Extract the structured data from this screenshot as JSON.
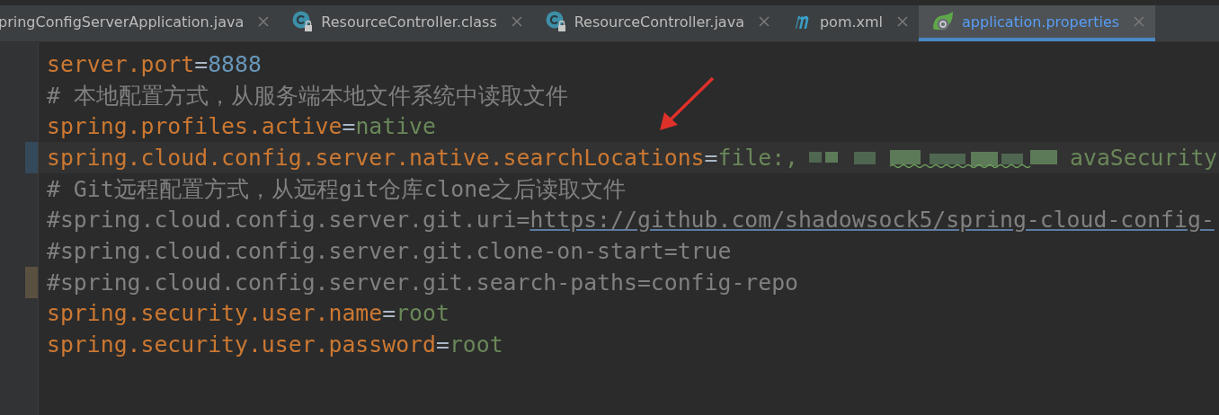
{
  "tabs": [
    {
      "label": "pringConfigServerApplication.java",
      "kind": "plain",
      "selected": false
    },
    {
      "label": "ResourceController.class",
      "kind": "class",
      "selected": false
    },
    {
      "label": "ResourceController.java",
      "kind": "class",
      "selected": false
    },
    {
      "label": "pom.xml",
      "kind": "maven",
      "selected": false
    },
    {
      "label": "application.properties",
      "kind": "spring",
      "selected": true
    }
  ],
  "editor": {
    "lines": [
      {
        "segments": [
          {
            "kind": "key",
            "text": "server.port"
          },
          {
            "kind": "op",
            "text": "="
          },
          {
            "kind": "number",
            "text": "8888"
          }
        ]
      },
      {
        "segments": [
          {
            "kind": "comment",
            "text": "# 本地配置方式，从服务端本地文件系统中读取文件"
          }
        ]
      },
      {
        "segments": [
          {
            "kind": "key",
            "text": "spring.profiles.active"
          },
          {
            "kind": "op",
            "text": "="
          },
          {
            "kind": "value",
            "text": "native"
          }
        ]
      },
      {
        "current": true,
        "segments": [
          {
            "kind": "key",
            "text": "spring.cloud.config.server.native.searchLocations"
          },
          {
            "kind": "op",
            "text": "="
          },
          {
            "kind": "value",
            "text": "file:,"
          },
          {
            "kind": "redacted"
          },
          {
            "kind": "value",
            "text": "avaSecurity"
          }
        ]
      },
      {
        "segments": [
          {
            "kind": "comment",
            "text": "# Git远程配置方式，从远程git仓库clone之后读取文件"
          }
        ]
      },
      {
        "segments": [
          {
            "kind": "comment",
            "text": "#spring.cloud.config.server.git.uri="
          },
          {
            "kind": "link",
            "text": "https://github.com/shadowsock5/spring-cloud-config-"
          }
        ]
      },
      {
        "segments": [
          {
            "kind": "comment",
            "text": "#spring.cloud.config.server.git.clone-on-start=true"
          }
        ]
      },
      {
        "changed": true,
        "segments": [
          {
            "kind": "comment",
            "text": "#spring.cloud.config.server.git.search-paths=config-repo"
          }
        ]
      },
      {
        "segments": [
          {
            "kind": "key",
            "text": "spring.security.user.name"
          },
          {
            "kind": "op",
            "text": "="
          },
          {
            "kind": "value",
            "text": "root"
          }
        ]
      },
      {
        "segments": [
          {
            "kind": "key",
            "text": "spring.security.user.password"
          },
          {
            "kind": "op",
            "text": "="
          },
          {
            "kind": "value",
            "text": "root"
          }
        ]
      }
    ]
  }
}
